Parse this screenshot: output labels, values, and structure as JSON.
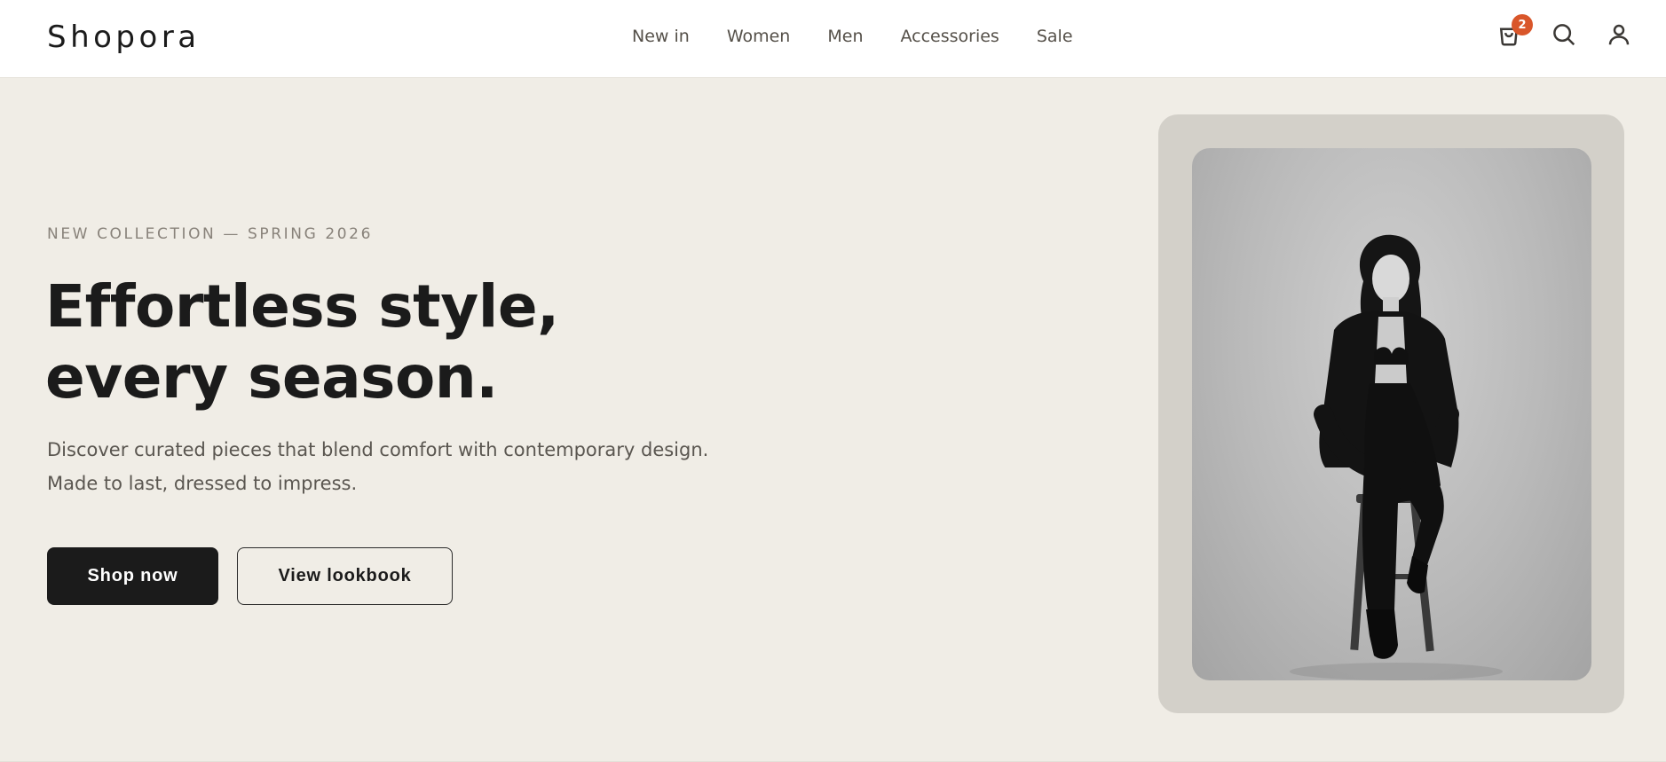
{
  "header": {
    "logo": "Shopora",
    "nav": [
      "New in",
      "Women",
      "Men",
      "Accessories",
      "Sale"
    ],
    "cart_count": "2",
    "icons": [
      "cart-icon",
      "search-icon",
      "user-icon"
    ]
  },
  "hero": {
    "eyebrow": "NEW COLLECTION — SPRING 2026",
    "headline_line1": "Effortless style,",
    "headline_line2": "every season.",
    "sub_line1": "Discover curated pieces that blend comfort with contemporary design.",
    "sub_line2": "Made to last, dressed to impress.",
    "primary_cta": "Shop now",
    "secondary_cta": "View lookbook"
  },
  "colors": {
    "background": "#f0ede6",
    "header": "#ffffff",
    "primary": "#1b1b1b",
    "badge": "#d9562a",
    "card": "#d3d0c9"
  }
}
